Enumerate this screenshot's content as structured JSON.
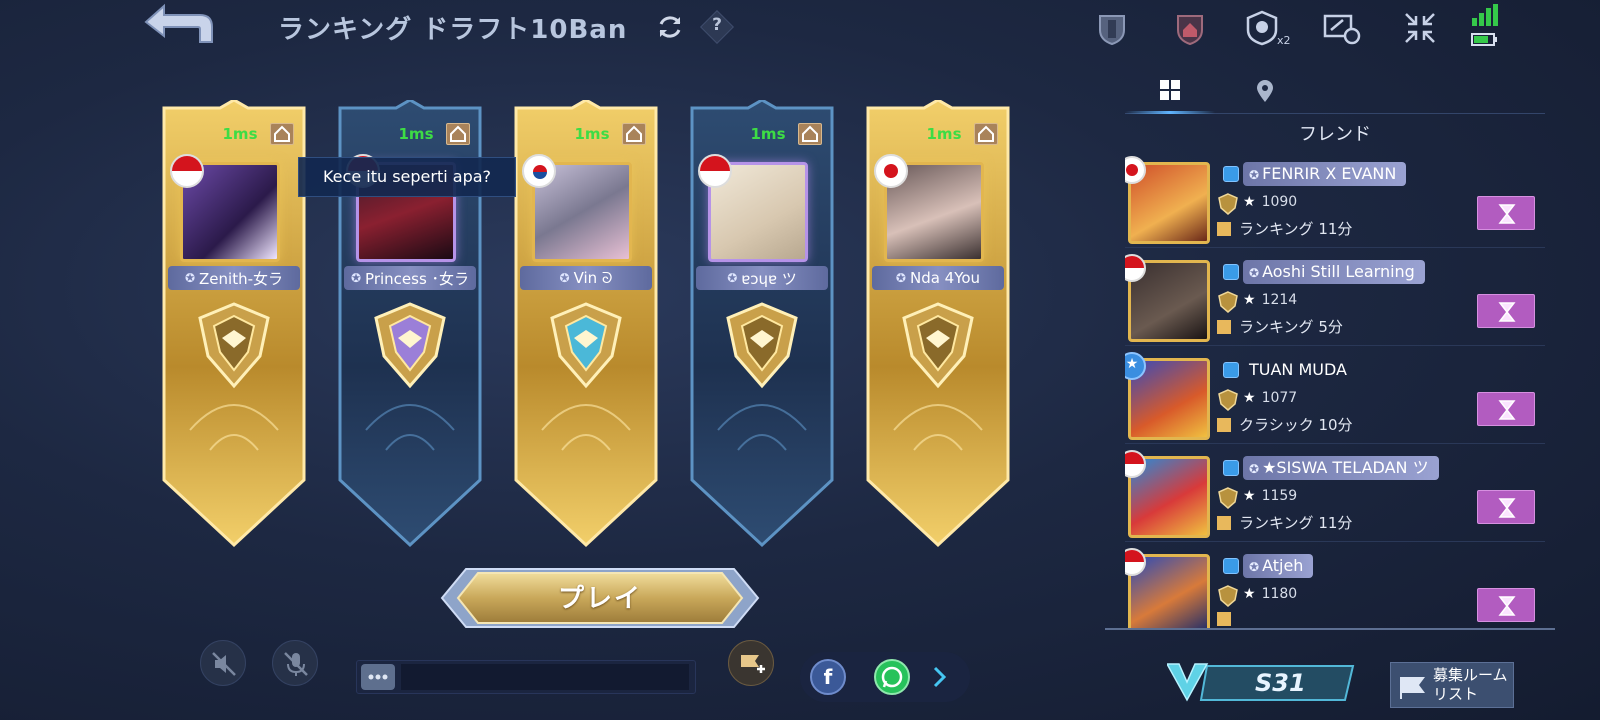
{
  "header": {
    "title": "ランキング ドラフト10Ban",
    "top_icons": [
      "shield-icon",
      "house-shield-icon",
      "party-x2-icon",
      "record-icon",
      "collapse-icon"
    ],
    "signal_icon": "signal-icon",
    "battery_icon": "battery-icon"
  },
  "lobby": {
    "slots": [
      {
        "ping": "1ms",
        "name": "Zenith-女ラ",
        "flag": "id",
        "style": "gold"
      },
      {
        "ping": "1ms",
        "name": "Princess ･女ラ",
        "flag": "id",
        "style": "blue"
      },
      {
        "ping": "1ms",
        "name": "Vin ᘐ",
        "flag": "kr",
        "style": "gold"
      },
      {
        "ping": "1ms",
        "name": "ɐɔɥɐ ツ",
        "flag": "id",
        "style": "blue"
      },
      {
        "ping": "1ms",
        "name": "Nda 4You",
        "flag": "jp",
        "style": "gold"
      }
    ],
    "tooltip": "Kece itu seperti apa?",
    "play_label": "プレイ"
  },
  "panel": {
    "title": "フレンド",
    "friends": [
      {
        "name": "FENRIR X EVANN",
        "points": "1090",
        "status": "ランキング 11分",
        "flag": "jp",
        "badge": true
      },
      {
        "name": "Aoshi Still Learning",
        "points": "1214",
        "status": "ランキング 5分",
        "flag": "id",
        "badge": true
      },
      {
        "name": "TUAN MUDA",
        "points": "1077",
        "status": "クラシック 10分",
        "flag": "star",
        "badge": false
      },
      {
        "name": "★SISWA TELADAN ツ",
        "points": "1159",
        "status": "ランキング 11分",
        "flag": "id",
        "badge": true
      },
      {
        "name": "Atjeh",
        "points": "1180",
        "status": "",
        "flag": "id",
        "badge": true
      }
    ]
  },
  "bottom": {
    "chat_placeholder": "",
    "season_label": "S31",
    "recruit_label": "募集ルームリスト"
  },
  "colors": {
    "gold": "#d9a93c",
    "blue_slot": "#2a4466",
    "ping_green": "#3ddc45",
    "invite_purple": "#b25cc0"
  }
}
